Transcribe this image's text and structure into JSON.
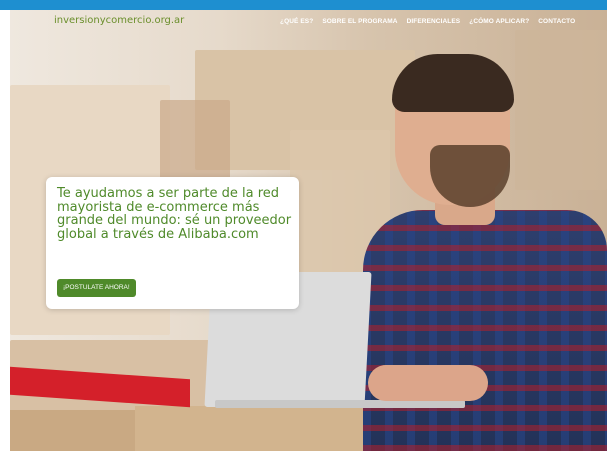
{
  "site": {
    "logo": "inversionycomercio.org.ar"
  },
  "nav": {
    "items": [
      {
        "label": "¿QUÉ ES?"
      },
      {
        "label": "SOBRE EL PROGRAMA"
      },
      {
        "label": "DIFERENCIALES"
      },
      {
        "label": "¿CÓMO APLICAR?"
      },
      {
        "label": "CONTACTO"
      }
    ]
  },
  "hero": {
    "headline": "Te ayudamos a ser parte de la red mayorista de e-commerce más grande del mundo: sé un proveedor global a través de Alibaba.com",
    "cta_label": "¡POSTULATE AHORA!"
  },
  "colors": {
    "accent_green": "#4f8a2a",
    "top_strip": "#1e8fd0"
  }
}
